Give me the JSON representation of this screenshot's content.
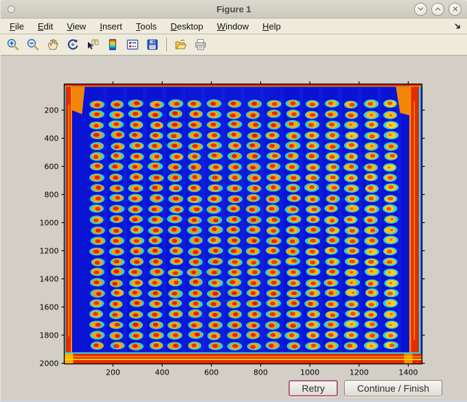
{
  "window": {
    "title": "Figure 1",
    "controls": [
      {
        "name": "shade-button",
        "glyph": "chevron-down"
      },
      {
        "name": "restore-button",
        "glyph": "chevron-up"
      },
      {
        "name": "close-button",
        "glyph": "x"
      }
    ]
  },
  "menubar": {
    "items": [
      {
        "label": "File"
      },
      {
        "label": "Edit"
      },
      {
        "label": "View"
      },
      {
        "label": "Insert"
      },
      {
        "label": "Tools"
      },
      {
        "label": "Desktop"
      },
      {
        "label": "Window"
      },
      {
        "label": "Help"
      }
    ]
  },
  "toolbar": {
    "icons": [
      "zoom-in",
      "zoom-out",
      "pan",
      "rotate-3d",
      "data-cursor",
      "insert-colorbar",
      "insert-legend",
      "save-figure",
      "open-file",
      "print-figure"
    ]
  },
  "figure": {
    "axes": {
      "x_ticks": [
        200,
        400,
        600,
        800,
        1000,
        1200,
        1400
      ],
      "y_ticks": [
        200,
        400,
        600,
        800,
        1000,
        1200,
        1400,
        1600,
        1800,
        2000
      ],
      "x_range": [
        1,
        1456
      ],
      "y_range": [
        1,
        2048
      ]
    },
    "plate": {
      "rows": 24,
      "cols": 16,
      "colors": {
        "background": "#0813d4",
        "band": "#1c33ea",
        "halo": "#2fe0d6",
        "mid_orange": "#ff9400",
        "mid_yellow": "#ffd028",
        "core_red": "#dd1c00",
        "core_orange": "#f07410",
        "frame_red": "#e42b00",
        "frame_orange": "#ff8c00",
        "frame_yellow": "#ffd400",
        "frame_cyan": "#2fd8e8"
      }
    }
  },
  "action_buttons": {
    "retry": "Retry",
    "continue": "Continue / Finish"
  },
  "chart_data": {
    "type": "heatmap",
    "title": "",
    "xlabel": "",
    "ylabel": "",
    "x_ticks": [
      200,
      400,
      600,
      800,
      1000,
      1200,
      1400
    ],
    "y_ticks": [
      200,
      400,
      600,
      800,
      1000,
      1200,
      1400,
      1600,
      1800,
      2000
    ],
    "xlim": [
      1,
      1456
    ],
    "ylim": [
      1,
      2048
    ],
    "colormap": "jet",
    "description": "Pseudo-colored image of a 384-spot (16 columns x 24 rows) dot-blot / microplate scan: blue background, red-hot plate edges, elliptical spots with cyan halos, yellow-orange rings and red cores",
    "grid": {
      "columns": 16,
      "rows": 24
    }
  }
}
